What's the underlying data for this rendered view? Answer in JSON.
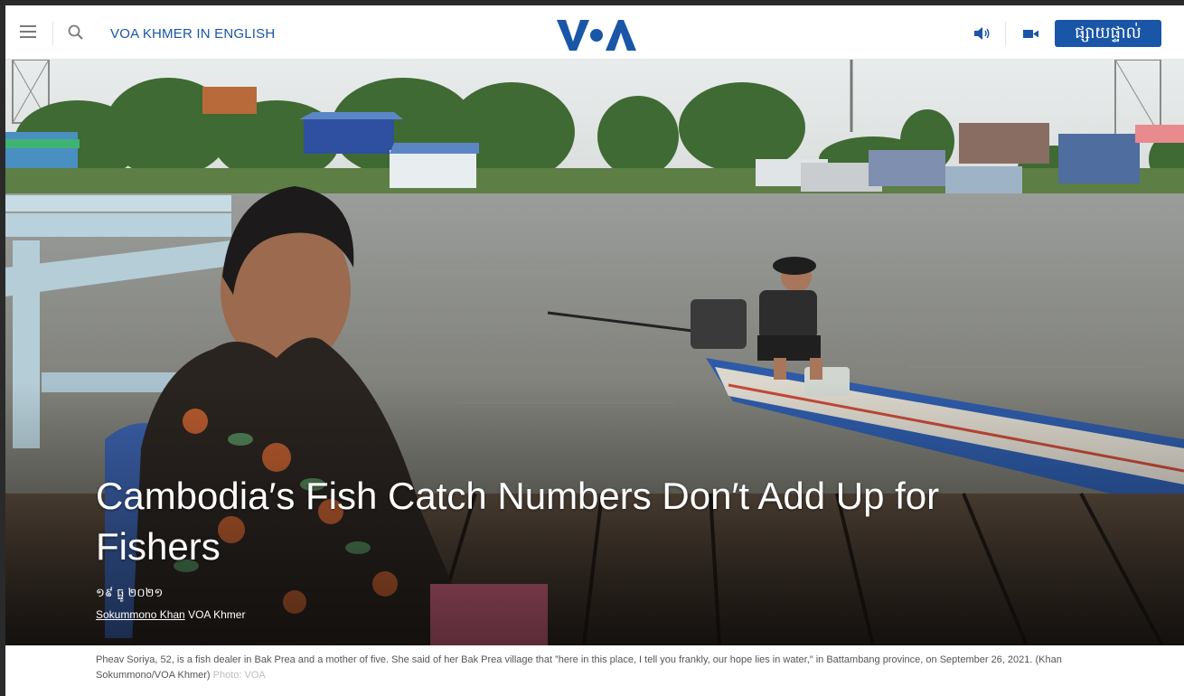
{
  "header": {
    "section_title": "VOA KHMER IN ENGLISH",
    "live_label": "ផ្សាយផ្ទាល់",
    "brand_color": "#1a56a8",
    "icons": [
      "menu-icon",
      "search-icon",
      "voa-logo",
      "speaker-icon",
      "video-camera-icon"
    ]
  },
  "article": {
    "headline": "Cambodia′s Fish Catch Numbers Don′t Add Up for Fishers",
    "date": "១៩ ធ្នូ ២០២១",
    "author": "Sokummono Khan",
    "outlet": "VOA Khmer"
  },
  "caption": {
    "text": "Pheav Soriya, 52, is a fish dealer in Bak Prea and a mother of five. She said of her Bak Prea village that ‟here in this place, I tell you frankly, our hope lies in water,″ in Battambang province, on September 26, 2021. (Khan Sokummono/VOA Khmer)",
    "credit": "Photo: VOA"
  }
}
